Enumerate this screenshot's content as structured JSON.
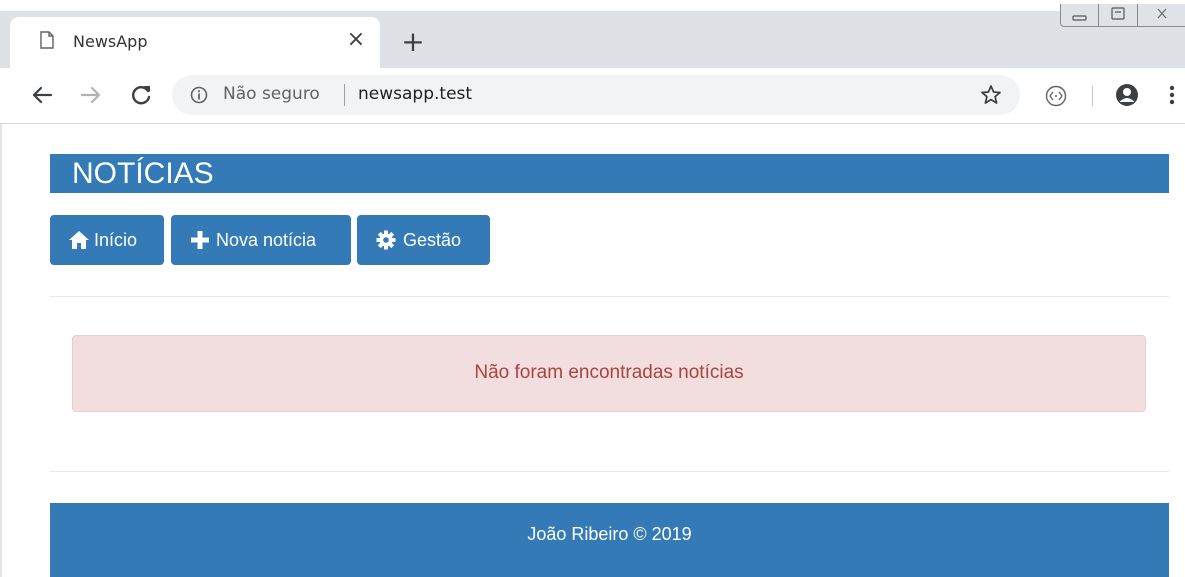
{
  "browser": {
    "tab_title": "NewsApp",
    "close_glyph": "×",
    "newtab_glyph": "+",
    "security_label": "Não seguro",
    "url": "newsapp.test"
  },
  "app": {
    "header_title": "NOTÍCIAS",
    "nav": {
      "home_label": "Início",
      "new_label": "Nova notícia",
      "manage_label": "Gestão"
    },
    "alert_text": "Não foram encontradas notícias",
    "footer_text": "João Ribeiro © 2019"
  },
  "colors": {
    "primary": "#337ab7",
    "alert_bg": "#f2dede",
    "alert_text": "#a94442"
  }
}
